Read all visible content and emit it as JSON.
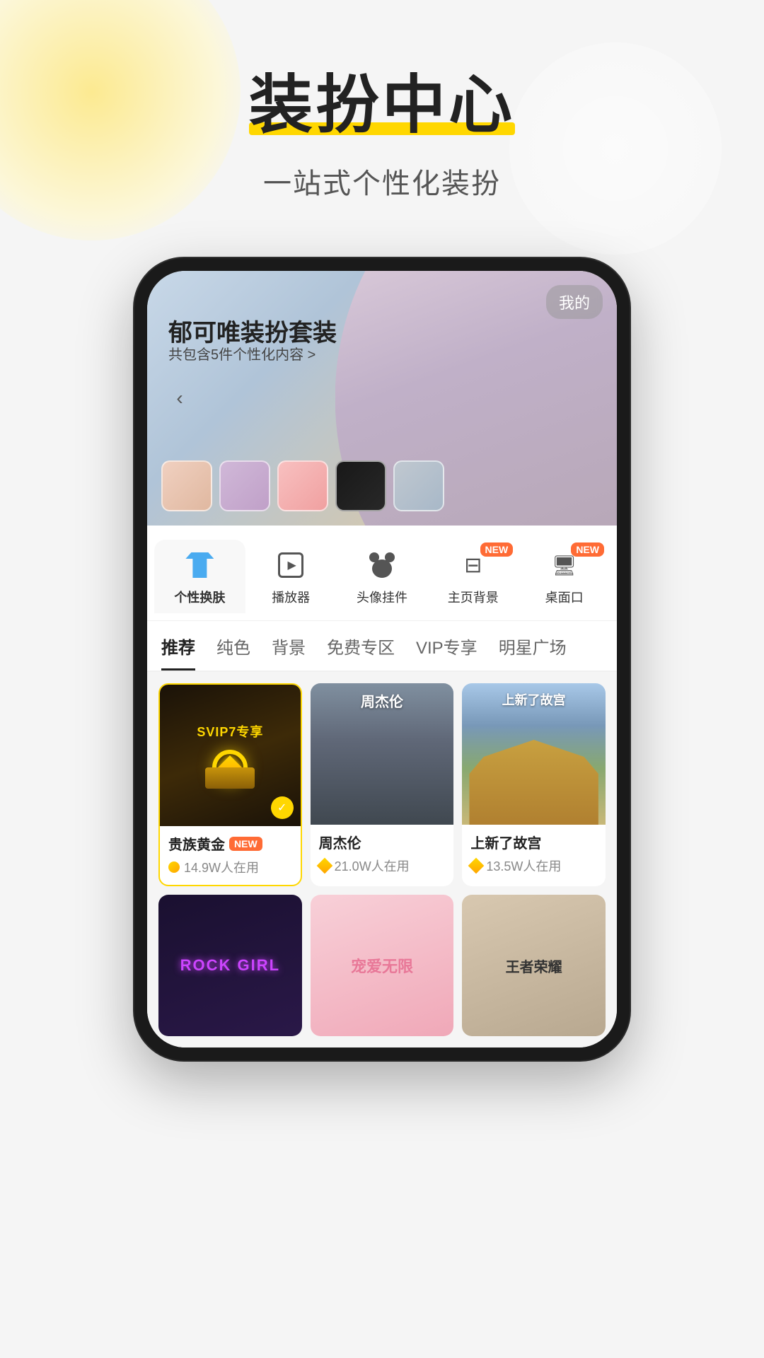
{
  "page": {
    "title": "装扮中心",
    "highlight_word": "中心",
    "subtitle": "一站式个性化装扮"
  },
  "hero": {
    "back_label": "‹",
    "my_label": "我的",
    "title": "郁可唯装扮套装",
    "subtitle": "共包含5件个性化内容 >",
    "dots": [
      false,
      true,
      false,
      false,
      false
    ]
  },
  "categories": [
    {
      "id": "skin",
      "label": "个性换肤",
      "icon": "shirt",
      "active": true,
      "new": false
    },
    {
      "id": "player",
      "label": "播放器",
      "icon": "player",
      "active": false,
      "new": false
    },
    {
      "id": "avatar",
      "label": "头像挂件",
      "icon": "mickey",
      "active": false,
      "new": false
    },
    {
      "id": "home-bg",
      "label": "主页背景",
      "icon": "home",
      "active": false,
      "new": true
    },
    {
      "id": "desktop",
      "label": "桌面口",
      "icon": "desktop",
      "active": false,
      "new": true
    }
  ],
  "filters": [
    {
      "label": "推荐",
      "active": true
    },
    {
      "label": "纯色",
      "active": false
    },
    {
      "label": "背景",
      "active": false
    },
    {
      "label": "免费专区",
      "active": false
    },
    {
      "label": "VIP专享",
      "active": false
    },
    {
      "label": "明星广场",
      "active": false
    }
  ],
  "skins_row1": [
    {
      "id": "svip-gold",
      "name": "贵族黄金",
      "badge_label": "SVIP7专享",
      "is_new": true,
      "user_count": "14.9W人在用",
      "icon_type": "coin",
      "border_gold": true
    },
    {
      "id": "jay-chou",
      "name": "周杰伦",
      "badge_label": "周杰伦",
      "is_new": false,
      "user_count": "21.0W人在用",
      "icon_type": "diamond"
    },
    {
      "id": "gugong",
      "name": "上新了故宫",
      "badge_label": "上新了故宫",
      "is_new": false,
      "user_count": "13.5W人在用",
      "icon_type": "diamond"
    }
  ],
  "skins_row2": [
    {
      "id": "rock-girl",
      "name": "ROCK GIRL",
      "is_new": false,
      "user_count": ""
    },
    {
      "id": "pet-love",
      "name": "宠爱无限",
      "is_new": false,
      "user_count": ""
    },
    {
      "id": "king-glory",
      "name": "王者荣耀",
      "is_new": false,
      "user_count": ""
    }
  ],
  "new_badge_label": "NEW"
}
